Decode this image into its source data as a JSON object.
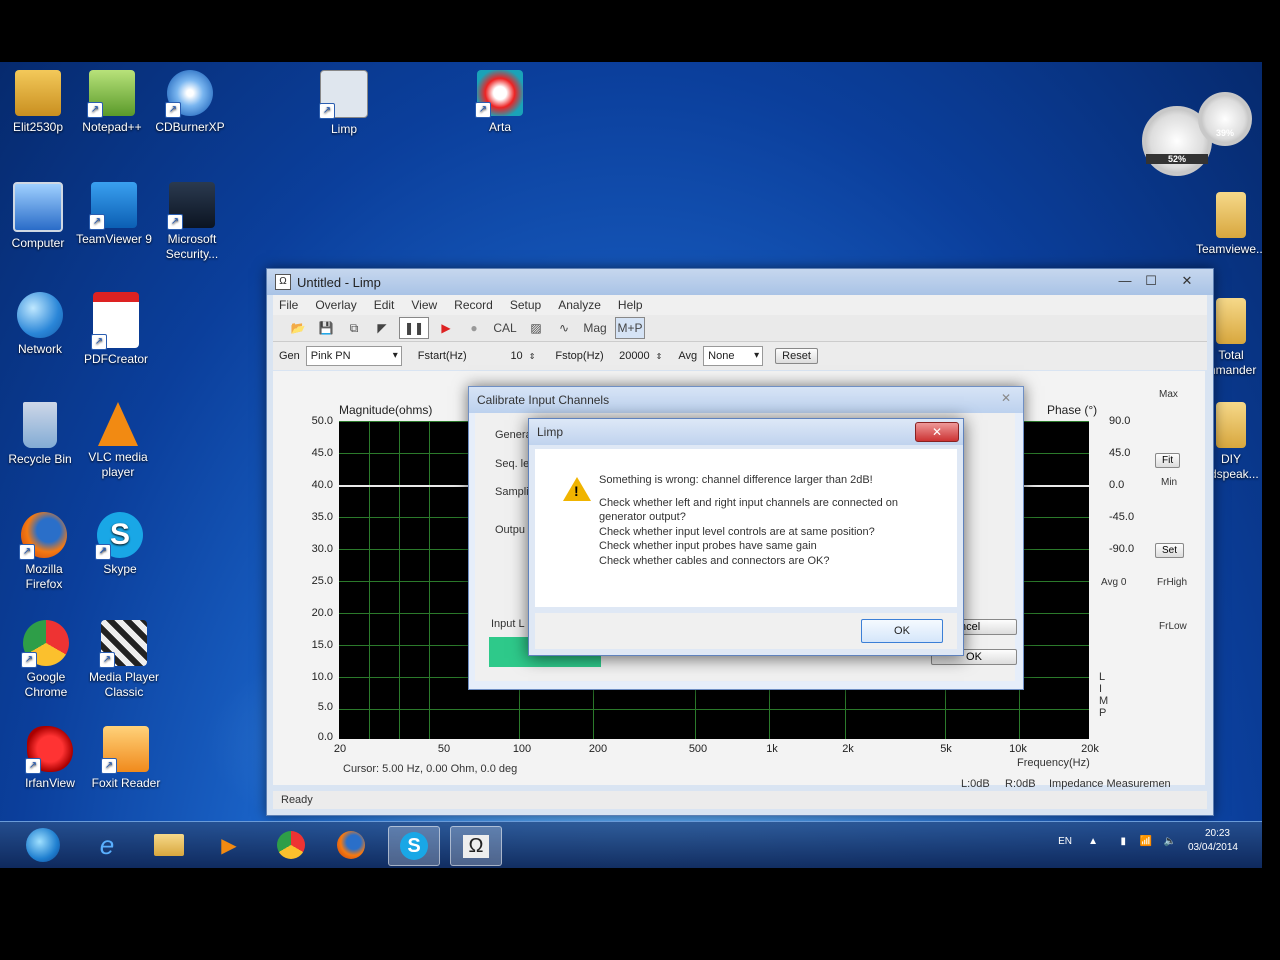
{
  "desktop": {
    "icons": [
      {
        "label": "Elit2530p"
      },
      {
        "label": "Notepad++"
      },
      {
        "label": "CDBurnerXP"
      },
      {
        "label": "Limp"
      },
      {
        "label": "Arta"
      },
      {
        "label": "Computer"
      },
      {
        "label": "TeamViewer 9"
      },
      {
        "label": "Microsoft Security..."
      },
      {
        "label": "Network"
      },
      {
        "label": "PDFCreator"
      },
      {
        "label": "Recycle Bin"
      },
      {
        "label": "VLC media player"
      },
      {
        "label": "Mozilla Firefox"
      },
      {
        "label": "Skype"
      },
      {
        "label": "Google Chrome"
      },
      {
        "label": "Media Player Classic"
      },
      {
        "label": "IrfanView"
      },
      {
        "label": "Foxit Reader"
      },
      {
        "label": "Teamviewe..."
      },
      {
        "label": "Total mmander"
      },
      {
        "label": "DIY udspeak..."
      }
    ],
    "gadgets": {
      "cpu": "52%",
      "mem": "39%"
    }
  },
  "window": {
    "title": "Untitled - Limp",
    "menu": [
      "File",
      "Overlay",
      "Edit",
      "View",
      "Record",
      "Setup",
      "Analyze",
      "Help"
    ],
    "toolbar": {
      "cal": "CAL",
      "mag": "Mag",
      "mp": "M+P"
    },
    "gen": {
      "gen_label": "Gen",
      "gen_value": "Pink PN",
      "fstart_label": "Fstart(Hz)",
      "fstart_value": "10",
      "fstop_label": "Fstop(Hz)",
      "fstop_value": "20000",
      "avg_label": "Avg",
      "avg_value": "None",
      "reset": "Reset"
    },
    "plot": {
      "y_title": "Magnitude(ohms)",
      "y_ticks": [
        "50.0",
        "45.0",
        "40.0",
        "35.0",
        "30.0",
        "25.0",
        "20.0",
        "15.0",
        "10.0",
        "5.0",
        "0.0"
      ],
      "phase_title": "Phase (°)",
      "phase_ticks": [
        "90.0",
        "45.0",
        "0.0",
        "-45.0",
        "-90.0"
      ],
      "x_ticks": [
        "20",
        "50",
        "100",
        "200",
        "500",
        "1k",
        "2k",
        "5k",
        "10k",
        "20k"
      ],
      "x_title": "Frequency(Hz)",
      "cursor": "Cursor: 5.00 Hz, 0.00 Ohm, 0.0 deg",
      "side_limp": "L I M P"
    },
    "side_panel": {
      "max": "Max",
      "fit": "Fit",
      "min": "Min",
      "set": "Set",
      "avg": "Avg 0",
      "frhigh": "FrHigh",
      "frlow": "FrLow"
    },
    "status": {
      "ready": "Ready",
      "l": "L:0dB",
      "r": "R:0dB",
      "mode": "Impedance Measuremen"
    }
  },
  "calibrate": {
    "title": "Calibrate Input Channels",
    "labels": {
      "general": "Genera",
      "seq": "Seq. le",
      "sampl": "Sampli",
      "output": "Outpu",
      "input": "Input L"
    },
    "cancel": "ncel",
    "ok": "OK"
  },
  "message": {
    "title": "Limp",
    "close": "✕",
    "line1": "Something is wrong: channel difference larger than 2dB!",
    "line2": "Check whether left and right input channels are connected on generator output?",
    "line3": "Check whether input level controls are at same position?",
    "line4": "Check whether input probes have same gain",
    "line5": "Check whether cables and connectors are OK?",
    "ok": "OK"
  },
  "taskbar": {
    "lang": "EN",
    "time": "20:23",
    "date": "03/04/2014"
  }
}
